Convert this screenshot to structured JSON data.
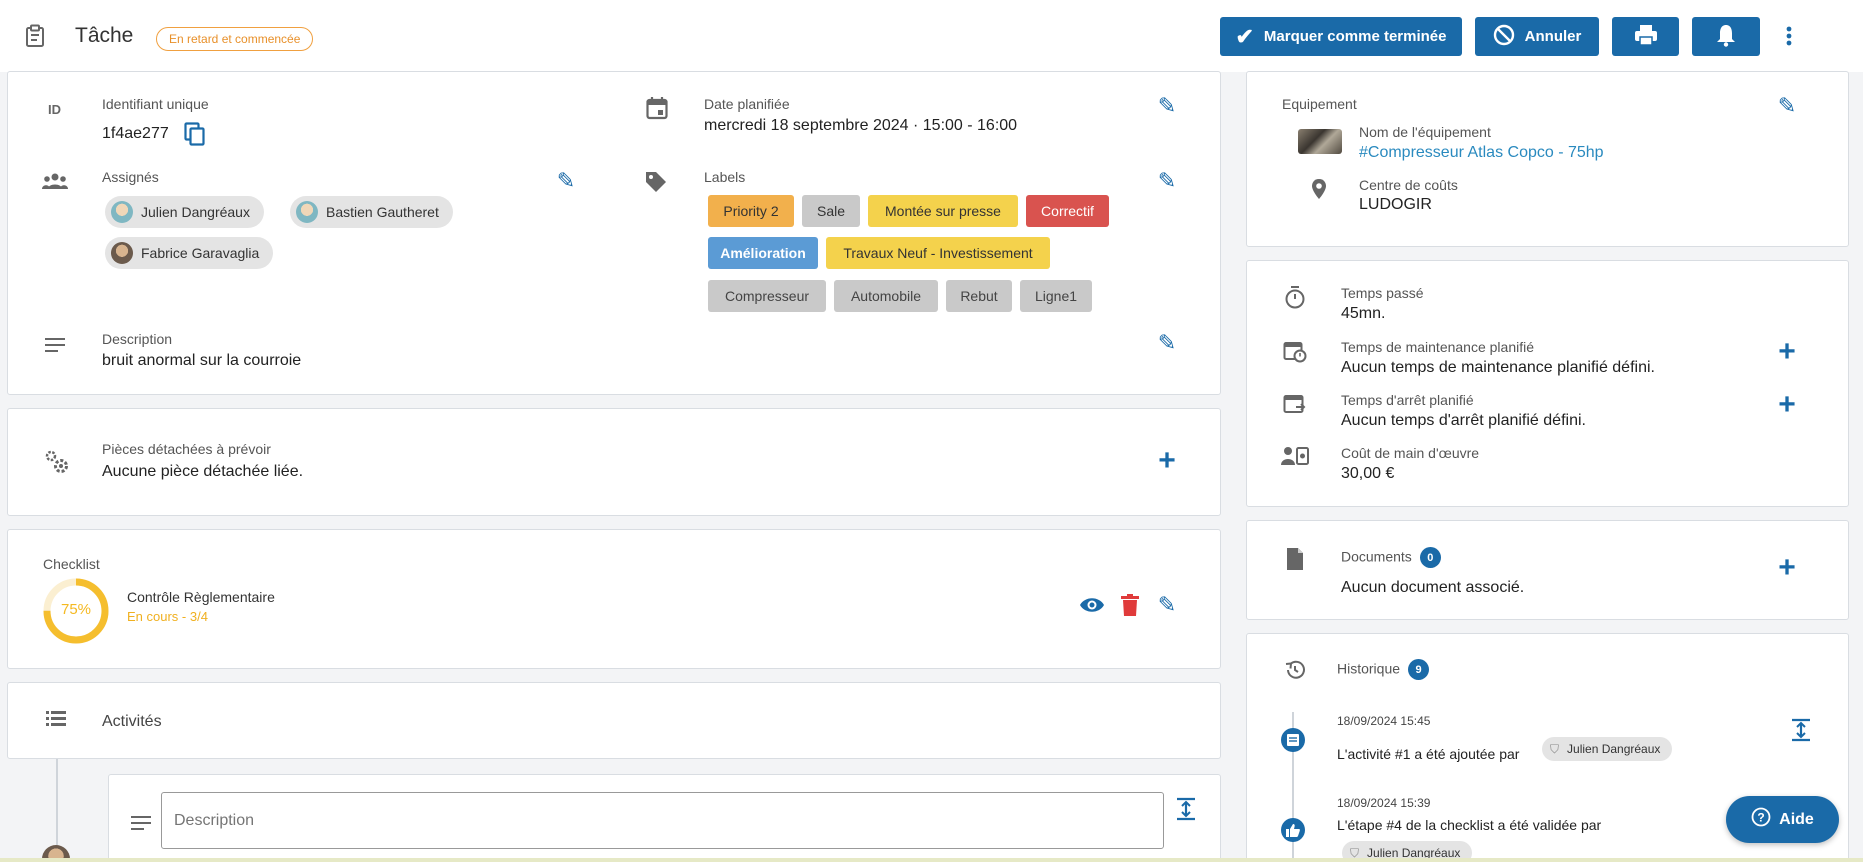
{
  "header": {
    "title": "Tâche",
    "status_badge": "En retard et commencée",
    "mark_done_label": "Marquer comme terminée",
    "cancel_label": "Annuler"
  },
  "details": {
    "uid_label": "Identifiant unique",
    "uid_value": "1f4ae277",
    "date_label": "Date planifiée",
    "date_value": "mercredi 18 septembre 2024 · 15:00 - 16:00",
    "assignees_label": "Assignés",
    "assignees": [
      "Julien Dangréaux",
      "Bastien Gautheret",
      "Fabrice Garavaglia"
    ],
    "labels_label": "Labels",
    "labels": [
      {
        "text": "Priority 2",
        "bg": "#f2b04c",
        "fg": "#333"
      },
      {
        "text": "Sale",
        "bg": "#c9c9c9",
        "fg": "#333"
      },
      {
        "text": "Montée sur presse",
        "bg": "#f4d24c",
        "fg": "#333"
      },
      {
        "text": "Correctif",
        "bg": "#d9534f",
        "fg": "#fff"
      },
      {
        "text": "Amélioration",
        "bg": "#5b9bd5",
        "fg": "#fff"
      },
      {
        "text": "Travaux Neuf - Investissement",
        "bg": "#f4d24c",
        "fg": "#333"
      },
      {
        "text": "Compresseur",
        "bg": "#c9c9c9",
        "fg": "#333"
      },
      {
        "text": "Automobile",
        "bg": "#c9c9c9",
        "fg": "#333"
      },
      {
        "text": "Rebut",
        "bg": "#c9c9c9",
        "fg": "#333"
      },
      {
        "text": "Ligne1",
        "bg": "#c9c9c9",
        "fg": "#333"
      }
    ],
    "description_label": "Description",
    "description_value": "bruit anormal sur la courroie"
  },
  "parts": {
    "label": "Pièces détachées à prévoir",
    "value": "Aucune pièce détachée liée."
  },
  "checklist": {
    "label": "Checklist",
    "percent": "75%",
    "progress": 0.75,
    "name": "Contrôle Règlementaire",
    "status": "En cours - 3/4"
  },
  "activities": {
    "label": "Activités",
    "description_placeholder": "Description"
  },
  "equipment": {
    "label": "Equipement",
    "name_label": "Nom de l'équipement",
    "name_value": "#Compresseur Atlas Copco - 75hp",
    "cost_center_label": "Centre de coûts",
    "cost_center_value": "LUDOGIR"
  },
  "times": {
    "spent_label": "Temps passé",
    "spent_value": "45mn.",
    "maint_label": "Temps de maintenance planifié",
    "maint_value": "Aucun temps de maintenance planifié défini.",
    "stop_label": "Temps d'arrêt planifié",
    "stop_value": "Aucun temps d'arrêt planifié défini.",
    "labor_label": "Coût de main d'œuvre",
    "labor_value": "30,00 €"
  },
  "documents": {
    "label": "Documents",
    "count": "0",
    "value": "Aucun document associé."
  },
  "history": {
    "label": "Historique",
    "count": "9",
    "entries": [
      {
        "date": "18/09/2024 15:45",
        "text": "L'activité #1 a été ajoutée par",
        "user": "Julien Dangréaux"
      },
      {
        "date": "18/09/2024 15:39",
        "text": "L'étape #4 de la checklist a été validée par",
        "user": "Julien Dangréaux"
      }
    ]
  },
  "help_label": "Aide"
}
